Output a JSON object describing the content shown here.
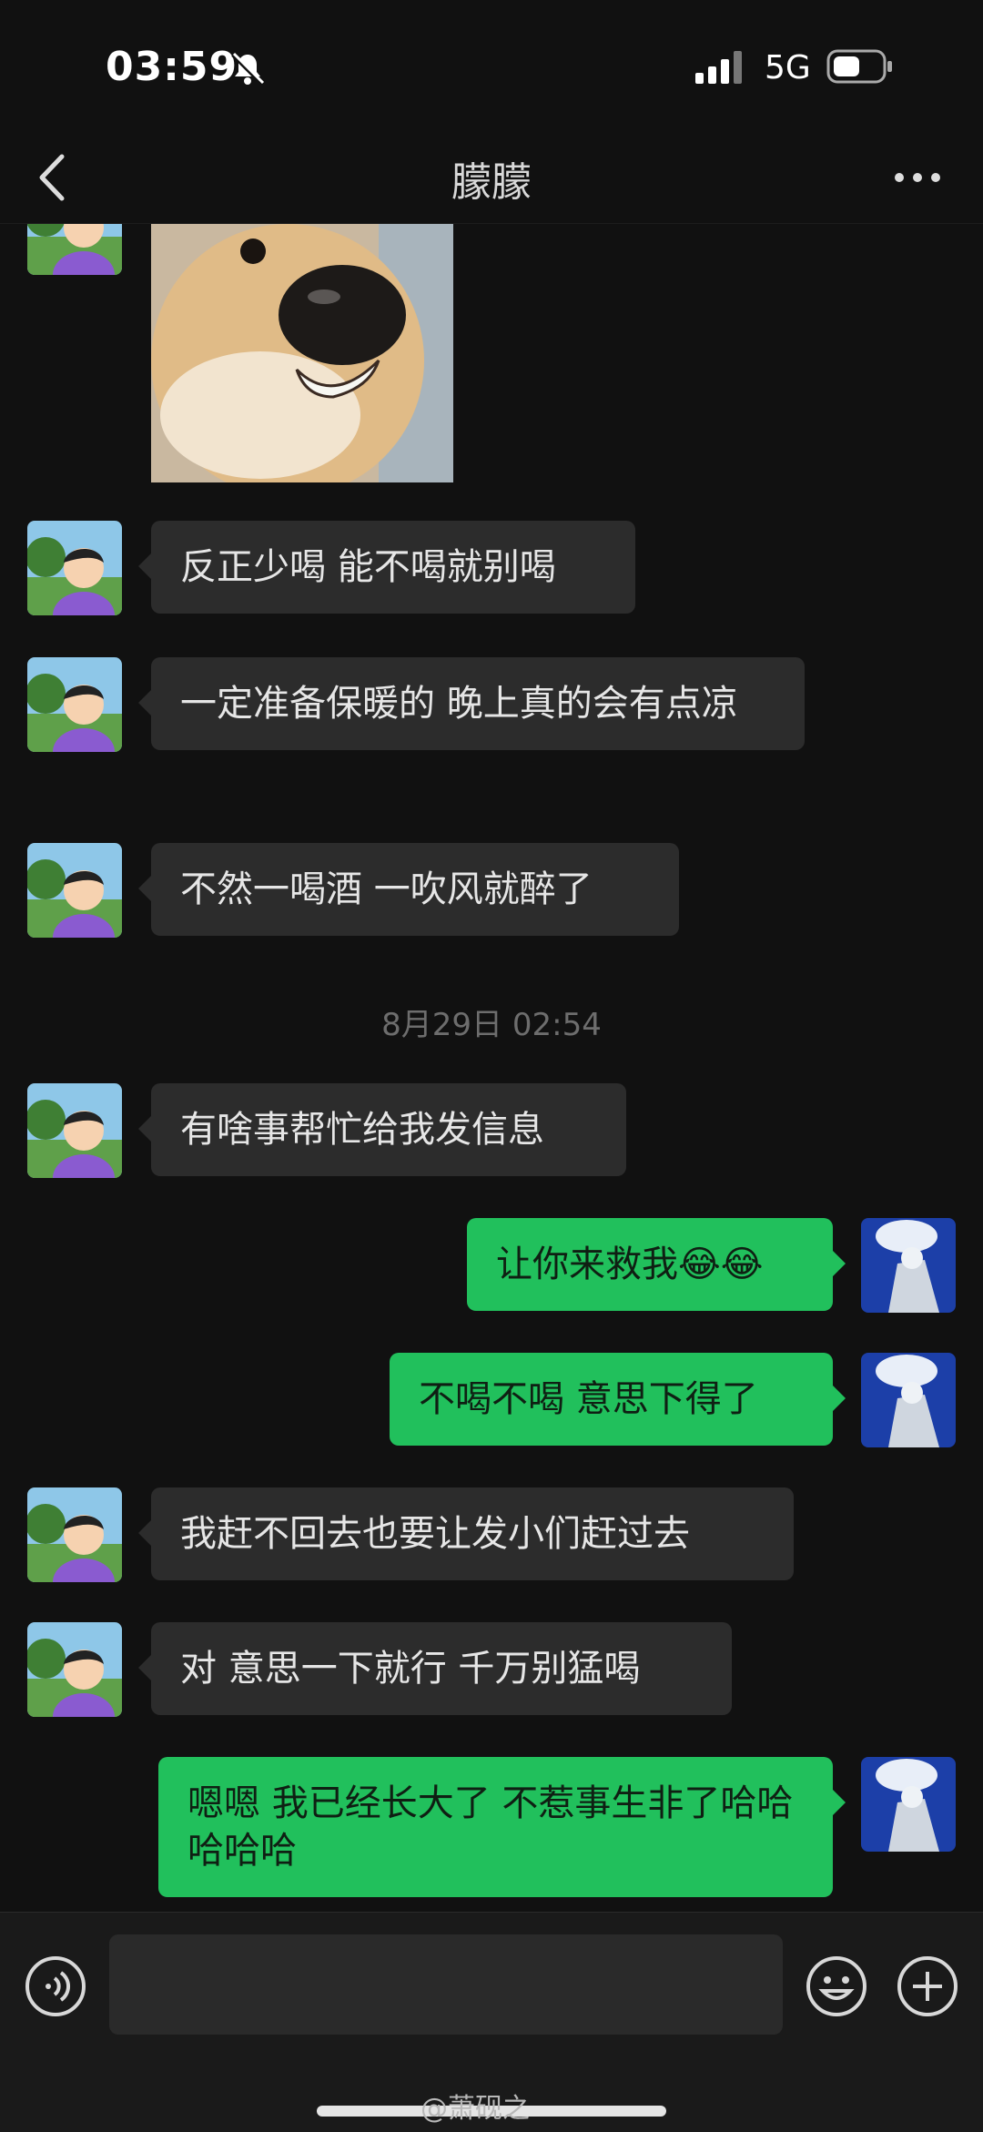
{
  "status_bar": {
    "time": "03:59",
    "network": "5G",
    "icons": [
      "bell-off-icon",
      "signal-icon",
      "battery-icon"
    ]
  },
  "header": {
    "title": "朦朦",
    "back_icon": "chevron-left-icon",
    "more_icon": "more-dots-icon"
  },
  "chat": {
    "contact_avatar": "cartoon-boy-avatar",
    "my_avatar": "blue-figure-avatar",
    "sticker": "dog-meme-sticker",
    "messages": [
      {
        "from": "contact",
        "text": "反正少喝 能不喝就别喝"
      },
      {
        "from": "contact",
        "text": "一定准备保暖的 晚上真的会有点凉"
      },
      {
        "from": "contact",
        "text": "不然一喝酒 一吹风就醉了"
      },
      {
        "from": "contact",
        "text": "有啥事帮忙给我发信息"
      },
      {
        "from": "me",
        "text": "让你来救我😂😂"
      },
      {
        "from": "me",
        "text": "不喝不喝 意思下得了"
      },
      {
        "from": "contact",
        "text": "我赶不回去也要让发小们赶过去"
      },
      {
        "from": "contact",
        "text": "对 意思一下就行 千万别猛喝"
      },
      {
        "from": "me",
        "text": "嗯嗯 我已经长大了 不惹事生非了哈哈哈哈哈"
      }
    ],
    "timestamp": "8月29日 02:54"
  },
  "input_bar": {
    "voice_icon": "voice-icon",
    "emoji_icon": "emoji-icon",
    "plus_icon": "plus-icon"
  },
  "watermark": "@萧砚之",
  "colors": {
    "background": "#111111",
    "incoming_bubble": "#2c2c2c",
    "outgoing_bubble": "#21c05c"
  }
}
